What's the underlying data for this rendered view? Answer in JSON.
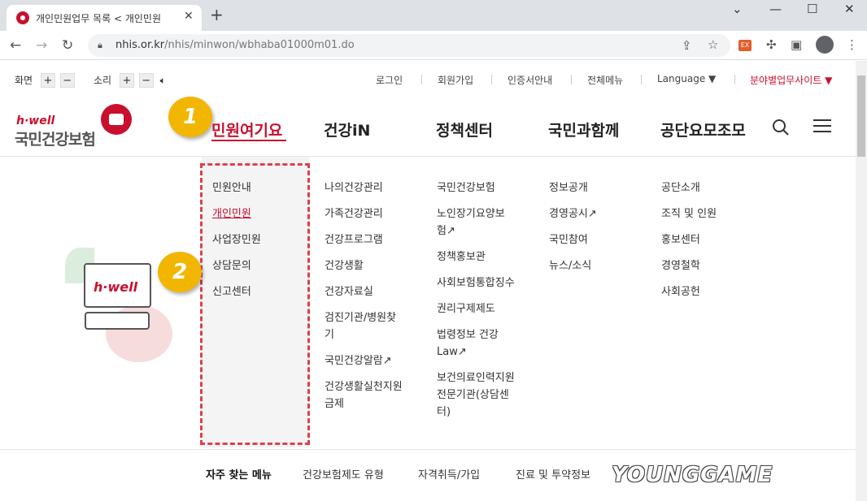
{
  "browser": {
    "tab_title": "개인민원업무 목록 < 개인민원",
    "url_host": "nhis.or.kr",
    "url_path": "/nhis/minwon/wbhaba01000m01.do",
    "ext_label": "EX"
  },
  "utility": {
    "screen_label": "화면",
    "sound_label": "소리",
    "plus": "+",
    "minus": "−",
    "links": [
      "로그인",
      "회원가입",
      "인증서안내",
      "전체메뉴"
    ],
    "language": "Language ▼",
    "field_sites": "분야별업무사이트 ▼"
  },
  "logo": {
    "hwell": "h·well",
    "name": "국민건강보험"
  },
  "gnb": [
    "민원여기요",
    "건강iN",
    "정책센터",
    "국민과함께",
    "공단요모조모"
  ],
  "badges": [
    "1",
    "2"
  ],
  "mega_menu": {
    "col1": [
      "민원안내",
      "개인민원",
      "사업장민원",
      "상담문의",
      "신고센터"
    ],
    "col2": [
      "나의건강관리",
      "가족건강관리",
      "건강프로그램",
      "건강생활",
      "건강자료실",
      "검진기관/병원찾\n기",
      "국민건강알람↗",
      "건강생활실천지원\n금제"
    ],
    "col3": [
      "국민건강보험",
      "노인장기요양보\n험↗",
      "정책홍보관",
      "사회보험통합징수",
      "권리구제제도",
      "법령정보 건강\nLaw↗",
      "보건의료인력지원\n전문기관(상담센\n터)"
    ],
    "col4": [
      "정보공개",
      "경영공시↗",
      "국민참여",
      "뉴스/소식"
    ],
    "col5": [
      "공단소개",
      "조직 및 인원",
      "홍보센터",
      "경영철학",
      "사회공헌"
    ]
  },
  "illustration": {
    "card_text": "h·well"
  },
  "quick_menu": {
    "title": "자주 찾는 메뉴",
    "items": [
      "건강보험제도 유형",
      "자격취득/가입",
      "진료 및 투약정보"
    ]
  },
  "watermark": "YOUNGGAME",
  "colors": {
    "accent": "#c8102e",
    "badge": "#f2b600",
    "highlight_box": "#e0404a"
  }
}
